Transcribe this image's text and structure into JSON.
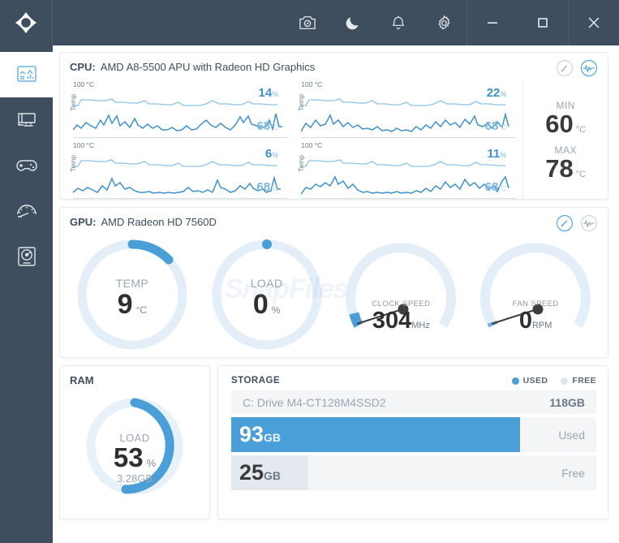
{
  "titlebar": {
    "logo_name": "app-logo",
    "buttons": [
      {
        "name": "screenshot-icon",
        "label": "Screenshot"
      },
      {
        "name": "moon-icon",
        "label": "Dark mode"
      },
      {
        "name": "bell-icon",
        "label": "Notifications"
      },
      {
        "name": "gear-icon",
        "label": "Settings"
      }
    ],
    "window_controls": [
      {
        "name": "minimize-button",
        "label": "Minimize"
      },
      {
        "name": "maximize-button",
        "label": "Maximize"
      },
      {
        "name": "close-button",
        "label": "Close"
      }
    ]
  },
  "sidebar": {
    "items": [
      {
        "name": "sidebar-item-dashboard",
        "label": "Dashboard",
        "active": true
      },
      {
        "name": "sidebar-item-monitor",
        "label": "Monitor",
        "active": false
      },
      {
        "name": "sidebar-item-gaming",
        "label": "Gaming",
        "active": false
      },
      {
        "name": "sidebar-item-benchmark",
        "label": "Benchmark",
        "active": false
      },
      {
        "name": "sidebar-item-storage",
        "label": "Storage",
        "active": false
      }
    ]
  },
  "colors": {
    "chrome": "#3e4e5e",
    "accent": "#4a9fd8",
    "accent_light": "#7fb6dd",
    "track": "#e4eef8",
    "panel_bg": "#f3f5f7"
  },
  "cpu": {
    "label": "CPU:",
    "model": "AMD A8-5500 APU with Radeon HD Graphics",
    "axis_top": "100 °C",
    "axis_side": "Temp",
    "mode_gauge_active": false,
    "mode_graph_active": true,
    "cores": [
      {
        "name": "cpu-core-1",
        "load": "14",
        "load_unit": "%",
        "temp": "68",
        "temp_unit": "°C"
      },
      {
        "name": "cpu-core-2",
        "load": "22",
        "load_unit": "%",
        "temp": "68",
        "temp_unit": "°C"
      },
      {
        "name": "cpu-core-3",
        "load": "6",
        "load_unit": "%",
        "temp": "68",
        "temp_unit": "°C"
      },
      {
        "name": "cpu-core-4",
        "load": "11",
        "load_unit": "%",
        "temp": "68",
        "temp_unit": "°C"
      }
    ],
    "min_label": "MIN",
    "min_value": "60",
    "min_unit": "°C",
    "max_label": "MAX",
    "max_value": "78",
    "max_unit": "°C"
  },
  "gpu": {
    "label": "GPU:",
    "model": "AMD Radeon HD 7560D",
    "mode_gauge_active": true,
    "mode_graph_active": false,
    "gauges": [
      {
        "name": "gpu-temp-gauge",
        "label": "TEMP",
        "value": "9",
        "unit": "°C",
        "pct": 9,
        "style": "donut"
      },
      {
        "name": "gpu-load-gauge",
        "label": "LOAD",
        "value": "0",
        "unit": "%",
        "pct": 0,
        "style": "donut"
      },
      {
        "name": "gpu-clock-gauge",
        "label": "CLOCK SPEED",
        "value": "304",
        "unit": "MHz",
        "pct": 5,
        "style": "needle"
      },
      {
        "name": "gpu-fan-gauge",
        "label": "FAN SPEED",
        "value": "0",
        "unit": "RPM",
        "pct": 0,
        "style": "needle"
      }
    ]
  },
  "ram": {
    "title": "RAM",
    "label": "LOAD",
    "value": "53",
    "unit": "%",
    "sub": "3.28GB",
    "pct": 53
  },
  "storage": {
    "title": "STORAGE",
    "legend": [
      {
        "name": "legend-used",
        "label": "USED",
        "color": "#4a9fd8"
      },
      {
        "name": "legend-free",
        "label": "FREE",
        "color": "#dde6ee"
      }
    ],
    "drive_name": "C: Drive M4-CT128M4SSD2",
    "drive_size": "118GB",
    "bars": [
      {
        "name": "storage-bar-used",
        "value": "93",
        "unit": "GB",
        "tag": "Used",
        "pct": 79,
        "color": "#4a9fd8"
      },
      {
        "name": "storage-bar-free",
        "value": "25",
        "unit": "GB",
        "tag": "Free",
        "pct": 21,
        "color": "#e3e9ef"
      }
    ]
  },
  "watermark": {
    "text": "SnapFiles"
  }
}
